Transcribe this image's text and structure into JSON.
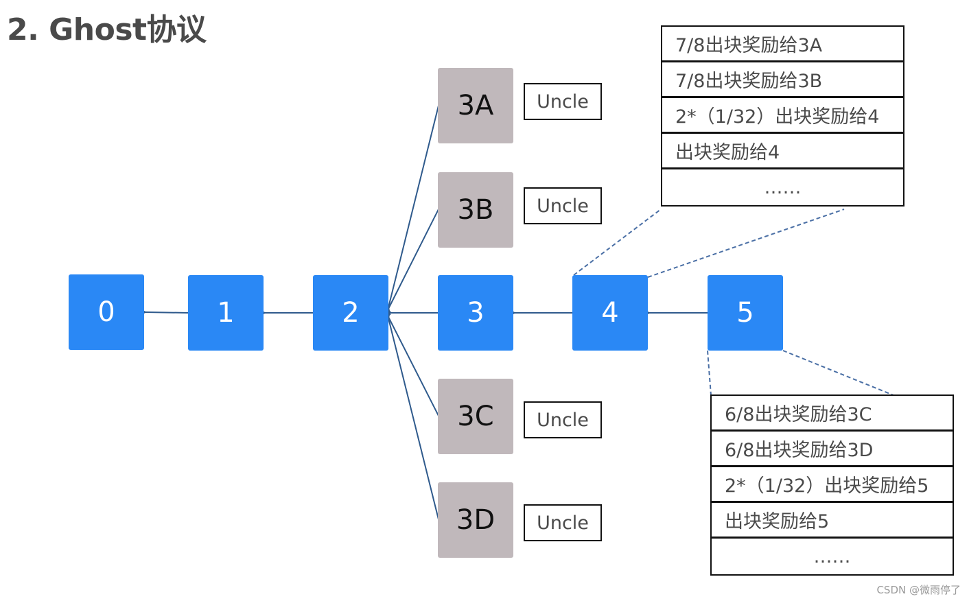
{
  "title": "2. Ghost协议",
  "colors": {
    "main_block": "#2a88f5",
    "uncle_block": "#c0b8bb",
    "arrow": "#2f5a8c",
    "dashed": "#4a6fa5"
  },
  "main_chain": [
    {
      "id": "0",
      "label": "0"
    },
    {
      "id": "1",
      "label": "1"
    },
    {
      "id": "2",
      "label": "2"
    },
    {
      "id": "3",
      "label": "3"
    },
    {
      "id": "4",
      "label": "4"
    },
    {
      "id": "5",
      "label": "5"
    }
  ],
  "uncles": [
    {
      "id": "3A",
      "label": "3A",
      "tag": "Uncle",
      "parent": "2"
    },
    {
      "id": "3B",
      "label": "3B",
      "tag": "Uncle",
      "parent": "2"
    },
    {
      "id": "3C",
      "label": "3C",
      "tag": "Uncle",
      "parent": "2"
    },
    {
      "id": "3D",
      "label": "3D",
      "tag": "Uncle",
      "parent": "2"
    }
  ],
  "edges": [
    {
      "from": "1",
      "to": "0"
    },
    {
      "from": "2",
      "to": "1"
    },
    {
      "from": "3",
      "to": "2"
    },
    {
      "from": "4",
      "to": "3"
    },
    {
      "from": "5",
      "to": "4"
    },
    {
      "from": "3A",
      "to": "2"
    },
    {
      "from": "3B",
      "to": "2"
    },
    {
      "from": "3C",
      "to": "2"
    },
    {
      "from": "3D",
      "to": "2"
    }
  ],
  "reward_tables": [
    {
      "block": "4",
      "rows": [
        "7/8出块奖励给3A",
        "7/8出块奖励给3B",
        "2*（1/32）出块奖励给4",
        "出块奖励给4",
        "……"
      ]
    },
    {
      "block": "5",
      "rows": [
        "6/8出块奖励给3C",
        "6/8出块奖励给3D",
        "2*（1/32）出块奖励给5",
        "出块奖励给5",
        "……"
      ]
    }
  ],
  "watermark": "CSDN @微雨停了"
}
